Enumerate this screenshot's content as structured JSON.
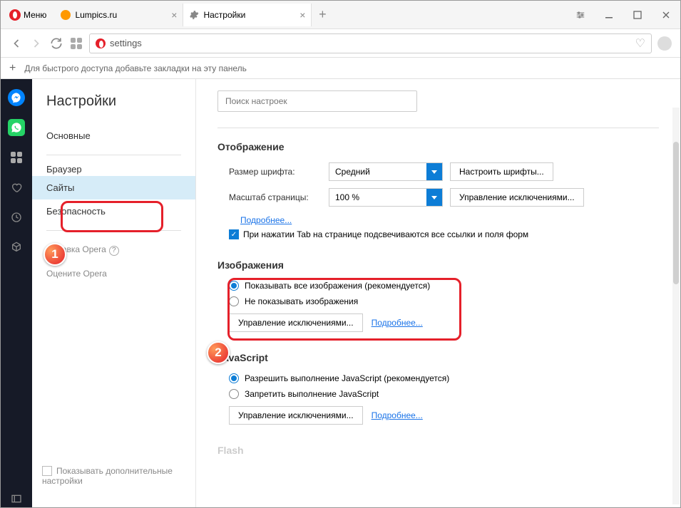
{
  "menu_label": "Меню",
  "tabs": [
    {
      "title": "Lumpics.ru"
    },
    {
      "title": "Настройки"
    }
  ],
  "url": "settings",
  "bookmarks_hint": "Для быстрого доступа добавьте закладки на эту панель",
  "settings_title": "Настройки",
  "nav": {
    "basic": "Основные",
    "browser": "Браузер",
    "sites": "Сайты",
    "security": "Безопасность",
    "help": "Справка Opera",
    "rate": "Оцените Opera"
  },
  "show_advanced": "Показывать дополнительные настройки",
  "search_placeholder": "Поиск настроек",
  "display": {
    "heading": "Отображение",
    "font_size_label": "Размер шрифта:",
    "font_size_value": "Средний",
    "fonts_btn": "Настроить шрифты...",
    "zoom_label": "Масштаб страницы:",
    "zoom_value": "100 %",
    "zoom_exc_btn": "Управление исключениями...",
    "more_link": "Подробнее...",
    "tab_checkbox": "При нажатии Tab на странице подсвечиваются все ссылки и поля форм"
  },
  "images": {
    "heading": "Изображения",
    "show_all": "Показывать все изображения (рекомендуется)",
    "hide_all": "Не показывать изображения",
    "exc_btn": "Управление исключениями...",
    "more_link": "Подробнее..."
  },
  "js": {
    "heading": "JavaScript",
    "allow": "Разрешить выполнение JavaScript (рекомендуется)",
    "deny": "Запретить выполнение JavaScript",
    "exc_btn": "Управление исключениями...",
    "more_link": "Подробнее..."
  },
  "flash_heading": "Flash",
  "badges": {
    "one": "1",
    "two": "2"
  }
}
